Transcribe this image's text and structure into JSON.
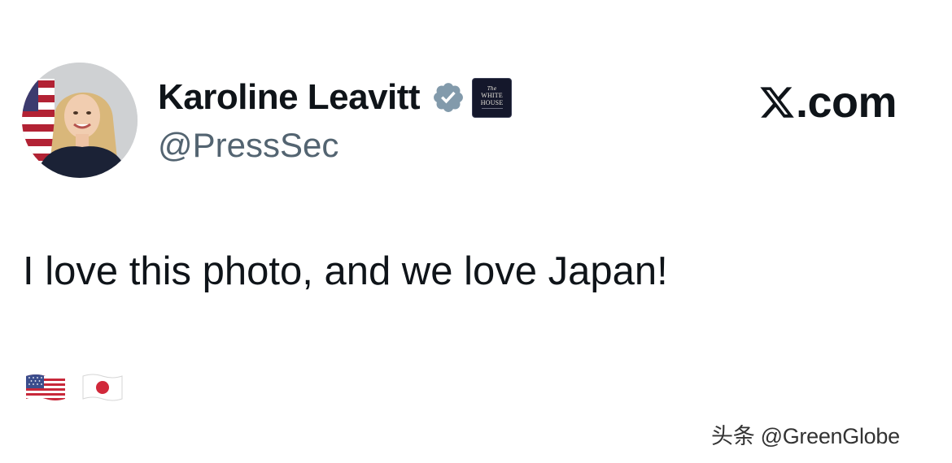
{
  "post": {
    "author": {
      "display_name": "Karoline Leavitt",
      "handle": "@PressSec",
      "verified": true,
      "affiliation_badge_lines": [
        "The",
        "WHITE",
        "HOUSE"
      ]
    },
    "text": "I love this photo, and we love Japan!",
    "emojis": [
      "flag-us",
      "flag-jp"
    ]
  },
  "brand": {
    "text": ".com",
    "logo_icon": "x-logo-icon"
  },
  "watermark": {
    "text": "头条 @GreenGlobe"
  },
  "colors": {
    "text_primary": "#0f1419",
    "text_secondary": "#536471",
    "verified_badge": "#829aab",
    "affiliation_bg": "#14172b",
    "background": "#ffffff"
  }
}
